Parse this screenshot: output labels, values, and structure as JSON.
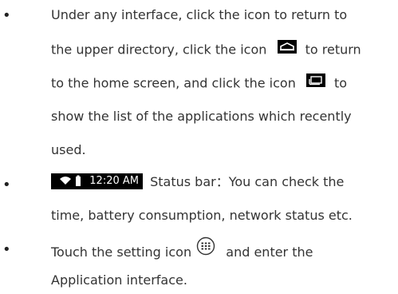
{
  "bullets": {
    "symbol": "•"
  },
  "item1": {
    "line1": "Under any interface, click the icon to return to",
    "line2a": "the upper directory, click the icon",
    "line2b": "to return",
    "line3a": "to the home screen, and click the icon",
    "line3b": "to",
    "line4": "show the list of the applications which recently",
    "line5": "used.",
    "home_icon": "home-icon",
    "recent_apps_icon": "recent-apps-icon"
  },
  "item2": {
    "status_time": "12:20 AM",
    "line1": "Status bar：You can check the",
    "line2": "time, battery consumption, network status etc.",
    "wifi_icon": "wifi-icon",
    "battery_icon": "battery-icon"
  },
  "item3": {
    "line1a": "Touch the setting icon",
    "line1b": "and enter the",
    "line2": "Application interface.",
    "apps_icon": "apps-grid-icon"
  },
  "colors": {
    "text": "#333333",
    "icon_bg": "#000000",
    "icon_fg": "#ffffff"
  }
}
